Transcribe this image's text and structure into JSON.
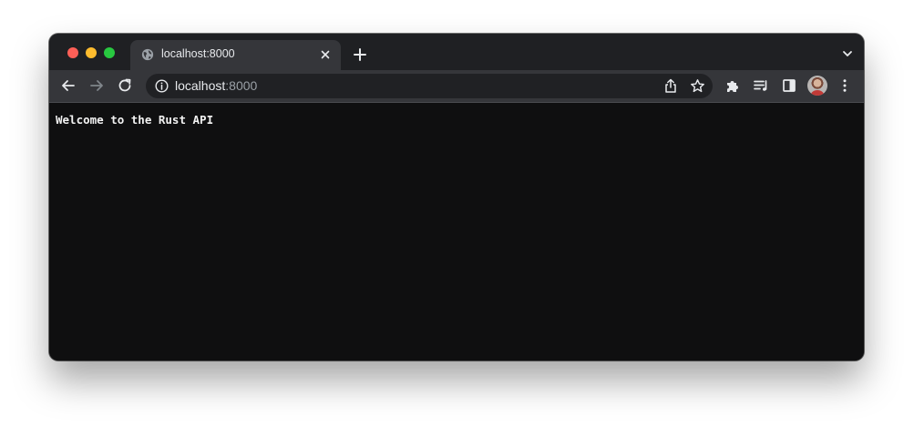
{
  "browser": {
    "tab": {
      "title": "localhost:8000",
      "icon": "globe-icon"
    },
    "address_bar": {
      "host": "localhost",
      "port": ":8000",
      "security_icon": "info-icon"
    },
    "icons": {
      "new_tab": "plus-icon",
      "tab_menu": "chevron-down-icon",
      "back": "back-arrow-icon",
      "forward": "forward-arrow-icon",
      "reload": "reload-icon",
      "share": "share-icon",
      "bookmark": "star-icon",
      "extensions": "puzzle-icon",
      "reading_list": "reading-list-icon",
      "side_panel": "side-panel-icon",
      "menu": "kebab-menu-icon"
    },
    "colors": {
      "frame": "#1f2023",
      "toolbar": "#35363a",
      "omnibox": "#202124",
      "page_background": "#0f0f10",
      "close": "#fe5f57",
      "minimize": "#febc2e",
      "maximize": "#28c840"
    }
  },
  "page": {
    "text": "Welcome to the Rust API"
  }
}
